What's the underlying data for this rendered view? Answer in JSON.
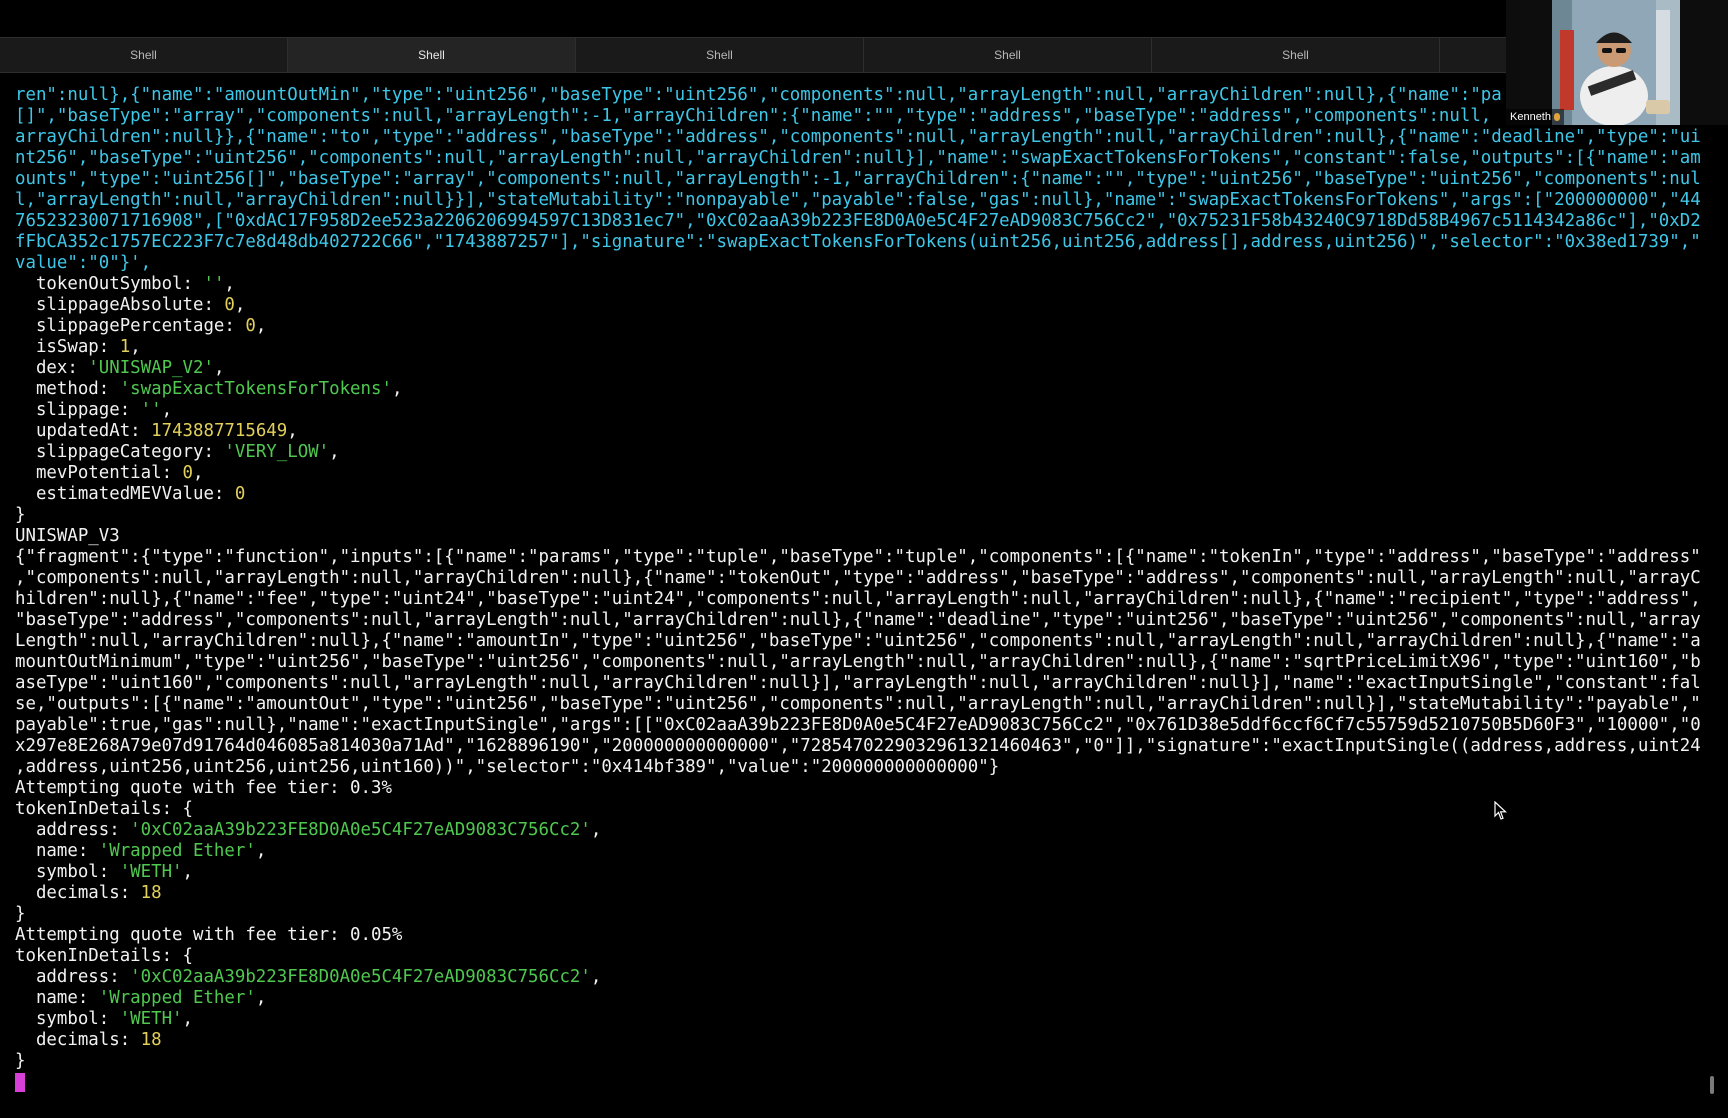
{
  "tabs": [
    {
      "label": "Shell",
      "active": false
    },
    {
      "label": "Shell",
      "active": true
    },
    {
      "label": "Shell",
      "active": false
    },
    {
      "label": "Shell",
      "active": false
    },
    {
      "label": "Shell",
      "active": false
    },
    {
      "label": "",
      "active": false
    }
  ],
  "video": {
    "participant_name": "Kenneth",
    "mic_icon": "microphone-icon"
  },
  "colors": {
    "cyan": "#3ec7e8",
    "green": "#4fc84f",
    "yellow": "#e2d05a",
    "cursor": "#d640d6"
  },
  "terminal": {
    "lines": [
      {
        "c": "cyan",
        "s": [
          [
            "ren\":null},{\"name\":\"amountOutMin\",\"type\":\"uint256\",\"baseType\":\"uint256\",\"components\":null,\"arrayLength\":null,\"arrayChildren\":null},{\"name\":\"pa",
            ""
          ]
        ]
      },
      {
        "c": "cyan",
        "s": [
          [
            "[]\",\"baseType\":\"array\",\"components\":null,\"arrayLength\":-1,\"arrayChildren\":{\"name\":\"\",\"type\":\"address\",\"baseType\":\"address\",\"components\":null,",
            ""
          ]
        ]
      },
      {
        "c": "cyan",
        "s": [
          [
            "arrayChildren\":null}},{\"name\":\"to\",\"type\":\"address\",\"baseType\":\"address\",\"components\":null,\"arrayLength\":null,\"arrayChildren\":null},{\"name\":\"deadline\",\"type\":\"ui",
            ""
          ]
        ]
      },
      {
        "c": "cyan",
        "s": [
          [
            "nt256\",\"baseType\":\"uint256\",\"components\":null,\"arrayLength\":null,\"arrayChildren\":null}],\"name\":\"swapExactTokensForTokens\",\"constant\":false,\"outputs\":[{\"name\":\"am",
            ""
          ]
        ]
      },
      {
        "c": "cyan",
        "s": [
          [
            "ounts\",\"type\":\"uint256[]\",\"baseType\":\"array\",\"components\":null,\"arrayLength\":-1,\"arrayChildren\":{\"name\":\"\",\"type\":\"uint256\",\"baseType\":\"uint256\",\"components\":nul",
            ""
          ]
        ]
      },
      {
        "c": "cyan",
        "s": [
          [
            "l,\"arrayLength\":null,\"arrayChildren\":null}}],\"stateMutability\":\"nonpayable\",\"payable\":false,\"gas\":null},\"name\":\"swapExactTokensForTokens\",\"args\":[\"200000000\",\"44",
            ""
          ]
        ]
      },
      {
        "c": "cyan",
        "s": [
          [
            "76523230071716908\",[\"0xdAC17F958D2ee523a2206206994597C13D831ec7\",\"0xC02aaA39b223FE8D0A0e5C4F27eAD9083C756Cc2\",\"0x75231F58b43240C9718Dd58B4967c5114342a86c\"],\"0xD2",
            ""
          ]
        ]
      },
      {
        "c": "cyan",
        "s": [
          [
            "fFbCA352c1757EC223F7c7e8d48db402722C66\",\"1743887257\"],\"signature\":\"swapExactTokensForTokens(uint256,uint256,address[],address,uint256)\",\"selector\":\"0x38ed1739\",\"",
            ""
          ]
        ]
      },
      {
        "c": "cyan",
        "s": [
          [
            "value\":\"0\"}',",
            ""
          ]
        ]
      },
      {
        "c": "white",
        "s": [
          [
            "  tokenOutSymbol: ",
            ""
          ],
          [
            "''",
            "green"
          ],
          [
            ",",
            ""
          ]
        ]
      },
      {
        "c": "white",
        "s": [
          [
            "  slippageAbsolute: ",
            ""
          ],
          [
            "0",
            "yellow"
          ],
          [
            ",",
            ""
          ]
        ]
      },
      {
        "c": "white",
        "s": [
          [
            "  slippagePercentage: ",
            ""
          ],
          [
            "0",
            "yellow"
          ],
          [
            ",",
            ""
          ]
        ]
      },
      {
        "c": "white",
        "s": [
          [
            "  isSwap: ",
            ""
          ],
          [
            "1",
            "yellow"
          ],
          [
            ",",
            ""
          ]
        ]
      },
      {
        "c": "white",
        "s": [
          [
            "  dex: ",
            ""
          ],
          [
            "'UNISWAP_V2'",
            "green"
          ],
          [
            ",",
            ""
          ]
        ]
      },
      {
        "c": "white",
        "s": [
          [
            "  method: ",
            ""
          ],
          [
            "'swapExactTokensForTokens'",
            "green"
          ],
          [
            ",",
            ""
          ]
        ]
      },
      {
        "c": "white",
        "s": [
          [
            "  slippage: ",
            ""
          ],
          [
            "''",
            "green"
          ],
          [
            ",",
            ""
          ]
        ]
      },
      {
        "c": "white",
        "s": [
          [
            "  updatedAt: ",
            ""
          ],
          [
            "1743887715649",
            "yellow"
          ],
          [
            ",",
            ""
          ]
        ]
      },
      {
        "c": "white",
        "s": [
          [
            "  slippageCategory: ",
            ""
          ],
          [
            "'VERY_LOW'",
            "green"
          ],
          [
            ",",
            ""
          ]
        ]
      },
      {
        "c": "white",
        "s": [
          [
            "  mevPotential: ",
            ""
          ],
          [
            "0",
            "yellow"
          ],
          [
            ",",
            ""
          ]
        ]
      },
      {
        "c": "white",
        "s": [
          [
            "  estimatedMEVValue: ",
            ""
          ],
          [
            "0",
            "yellow"
          ]
        ]
      },
      {
        "c": "white",
        "s": [
          [
            "}",
            ""
          ]
        ]
      },
      {
        "c": "white",
        "s": [
          [
            "UNISWAP_V3",
            ""
          ]
        ]
      },
      {
        "c": "white",
        "s": [
          [
            "{\"fragment\":{\"type\":\"function\",\"inputs\":[{\"name\":\"params\",\"type\":\"tuple\",\"baseType\":\"tuple\",\"components\":[{\"name\":\"tokenIn\",\"type\":\"address\",\"baseType\":\"address\"",
            ""
          ]
        ]
      },
      {
        "c": "white",
        "s": [
          [
            ",\"components\":null,\"arrayLength\":null,\"arrayChildren\":null},{\"name\":\"tokenOut\",\"type\":\"address\",\"baseType\":\"address\",\"components\":null,\"arrayLength\":null,\"arrayC",
            ""
          ]
        ]
      },
      {
        "c": "white",
        "s": [
          [
            "hildren\":null},{\"name\":\"fee\",\"type\":\"uint24\",\"baseType\":\"uint24\",\"components\":null,\"arrayLength\":null,\"arrayChildren\":null},{\"name\":\"recipient\",\"type\":\"address\",",
            ""
          ]
        ]
      },
      {
        "c": "white",
        "s": [
          [
            "\"baseType\":\"address\",\"components\":null,\"arrayLength\":null,\"arrayChildren\":null},{\"name\":\"deadline\",\"type\":\"uint256\",\"baseType\":\"uint256\",\"components\":null,\"array",
            ""
          ]
        ]
      },
      {
        "c": "white",
        "s": [
          [
            "Length\":null,\"arrayChildren\":null},{\"name\":\"amountIn\",\"type\":\"uint256\",\"baseType\":\"uint256\",\"components\":null,\"arrayLength\":null,\"arrayChildren\":null},{\"name\":\"a",
            ""
          ]
        ]
      },
      {
        "c": "white",
        "s": [
          [
            "mountOutMinimum\",\"type\":\"uint256\",\"baseType\":\"uint256\",\"components\":null,\"arrayLength\":null,\"arrayChildren\":null},{\"name\":\"sqrtPriceLimitX96\",\"type\":\"uint160\",\"b",
            ""
          ]
        ]
      },
      {
        "c": "white",
        "s": [
          [
            "aseType\":\"uint160\",\"components\":null,\"arrayLength\":null,\"arrayChildren\":null}],\"arrayLength\":null,\"arrayChildren\":null}],\"name\":\"exactInputSingle\",\"constant\":fal",
            ""
          ]
        ]
      },
      {
        "c": "white",
        "s": [
          [
            "se,\"outputs\":[{\"name\":\"amountOut\",\"type\":\"uint256\",\"baseType\":\"uint256\",\"components\":null,\"arrayLength\":null,\"arrayChildren\":null}],\"stateMutability\":\"payable\",\"",
            ""
          ]
        ]
      },
      {
        "c": "white",
        "s": [
          [
            "payable\":true,\"gas\":null},\"name\":\"exactInputSingle\",\"args\":[[\"0xC02aaA39b223FE8D0A0e5C4F27eAD9083C756Cc2\",\"0x761D38e5ddf6ccf6Cf7c55759d5210750B5D60F3\",\"10000\",\"0",
            ""
          ]
        ]
      },
      {
        "c": "white",
        "s": [
          [
            "x297e8E268A79e07d91764d046085a814030a71Ad\",\"1628896190\",\"200000000000000\",\"7285470229032961321460463\",\"0\"]],\"signature\":\"exactInputSingle((address,address,uint24",
            ""
          ]
        ]
      },
      {
        "c": "white",
        "s": [
          [
            ",address,uint256,uint256,uint256,uint160))\",\"selector\":\"0x414bf389\",\"value\":\"200000000000000\"}",
            ""
          ]
        ]
      },
      {
        "c": "white",
        "s": [
          [
            "Attempting quote with fee tier: 0.3%",
            ""
          ]
        ]
      },
      {
        "c": "white",
        "s": [
          [
            "tokenInDetails: {",
            ""
          ]
        ]
      },
      {
        "c": "white",
        "s": [
          [
            "  address: ",
            ""
          ],
          [
            "'0xC02aaA39b223FE8D0A0e5C4F27eAD9083C756Cc2'",
            "green"
          ],
          [
            ",",
            ""
          ]
        ]
      },
      {
        "c": "white",
        "s": [
          [
            "  name: ",
            ""
          ],
          [
            "'Wrapped Ether'",
            "green"
          ],
          [
            ",",
            ""
          ]
        ]
      },
      {
        "c": "white",
        "s": [
          [
            "  symbol: ",
            ""
          ],
          [
            "'WETH'",
            "green"
          ],
          [
            ",",
            ""
          ]
        ]
      },
      {
        "c": "white",
        "s": [
          [
            "  decimals: ",
            ""
          ],
          [
            "18",
            "yellow"
          ]
        ]
      },
      {
        "c": "white",
        "s": [
          [
            "}",
            ""
          ]
        ]
      },
      {
        "c": "white",
        "s": [
          [
            "Attempting quote with fee tier: 0.05%",
            ""
          ]
        ]
      },
      {
        "c": "white",
        "s": [
          [
            "tokenInDetails: {",
            ""
          ]
        ]
      },
      {
        "c": "white",
        "s": [
          [
            "  address: ",
            ""
          ],
          [
            "'0xC02aaA39b223FE8D0A0e5C4F27eAD9083C756Cc2'",
            "green"
          ],
          [
            ",",
            ""
          ]
        ]
      },
      {
        "c": "white",
        "s": [
          [
            "  name: ",
            ""
          ],
          [
            "'Wrapped Ether'",
            "green"
          ],
          [
            ",",
            ""
          ]
        ]
      },
      {
        "c": "white",
        "s": [
          [
            "  symbol: ",
            ""
          ],
          [
            "'WETH'",
            "green"
          ],
          [
            ",",
            ""
          ]
        ]
      },
      {
        "c": "white",
        "s": [
          [
            "  decimals: ",
            ""
          ],
          [
            "18",
            "yellow"
          ]
        ]
      },
      {
        "c": "white",
        "s": [
          [
            "}",
            ""
          ]
        ]
      }
    ]
  }
}
